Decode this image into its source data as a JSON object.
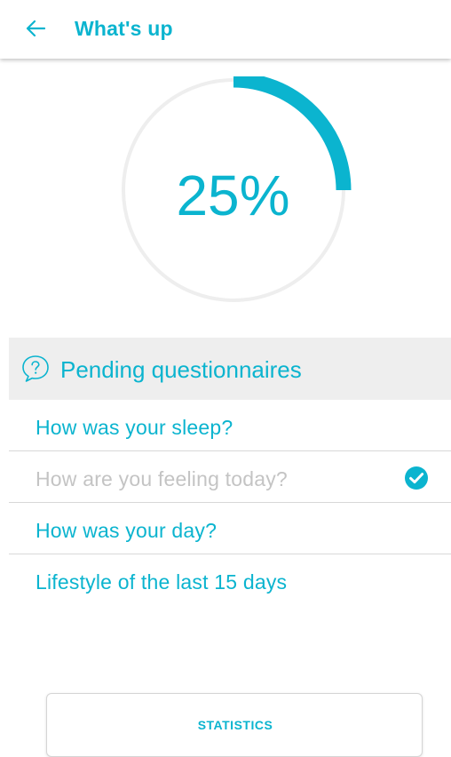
{
  "app_bar": {
    "back_icon": "arrow-left-icon",
    "title": "What's up"
  },
  "progress": {
    "label": "25%",
    "fraction": 0.25
  },
  "pending": {
    "icon": "question-bubble-icon",
    "title": "Pending questionnaires"
  },
  "questionnaires": [
    {
      "label": "How was your sleep?",
      "completed": false
    },
    {
      "label": "How are you feeling today?",
      "completed": true
    },
    {
      "label": "How was your day?",
      "completed": false
    },
    {
      "label": "Lifestyle of the last 15 days",
      "completed": false
    }
  ],
  "statistics_button": {
    "label": "STATISTICS"
  },
  "colors": {
    "accent": "#0bb4cf",
    "track": "#eeeeee",
    "section_bg": "#eeeeee",
    "completed_text": "#c4c4c4"
  }
}
